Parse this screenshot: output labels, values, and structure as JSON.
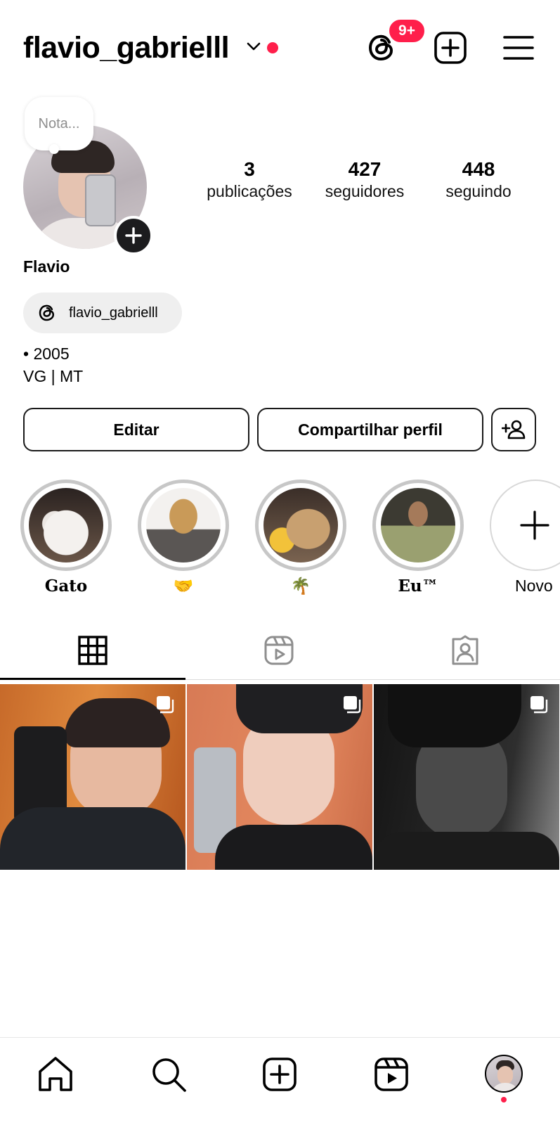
{
  "header": {
    "username": "flavio_gabrielll",
    "notification_badge": "9+",
    "accent_color": "#ff1f4b"
  },
  "profile": {
    "note_placeholder": "Nota...",
    "display_name": "Flavio",
    "threads_handle": "flavio_gabrielll",
    "bio_line1": "• 2005",
    "bio_line2": "VG | MT",
    "stats": [
      {
        "value": "3",
        "label": "publicações"
      },
      {
        "value": "427",
        "label": "seguidores"
      },
      {
        "value": "448",
        "label": "seguindo"
      }
    ]
  },
  "actions": {
    "edit_label": "Editar",
    "share_label": "Compartilhar perfil"
  },
  "highlights": [
    {
      "label": "Gato"
    },
    {
      "label": "🤝"
    },
    {
      "label": "🌴"
    },
    {
      "label": "Eu™"
    },
    {
      "label": "Novo"
    }
  ],
  "tabs": [
    {
      "icon": "grid-icon",
      "active": true
    },
    {
      "icon": "reels-icon",
      "active": false
    },
    {
      "icon": "tagged-icon",
      "active": false
    }
  ],
  "bottom_nav": [
    {
      "icon": "home-icon"
    },
    {
      "icon": "search-icon"
    },
    {
      "icon": "create-icon"
    },
    {
      "icon": "reels-icon"
    },
    {
      "icon": "profile-avatar"
    }
  ]
}
